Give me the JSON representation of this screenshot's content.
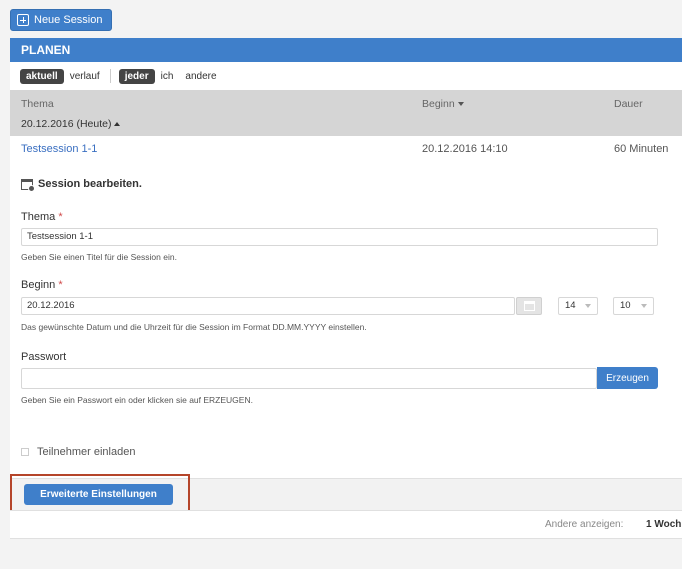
{
  "toolbar": {
    "new_session_label": "Neue Session"
  },
  "planen": {
    "title": "PLANEN"
  },
  "filters": {
    "time": [
      {
        "label": "aktuell",
        "active": true
      },
      {
        "label": "verlauf",
        "active": false
      }
    ],
    "owner": [
      {
        "label": "jeder",
        "active": true
      },
      {
        "label": "ich",
        "active": false
      },
      {
        "label": "andere",
        "active": false
      }
    ]
  },
  "table": {
    "columns": {
      "thema": "Thema",
      "beginn": "Beginn",
      "dauer": "Dauer"
    },
    "date_group": "20.12.2016 (Heute)",
    "row": {
      "thema": "Testsession 1-1",
      "beginn": "20.12.2016 14:10",
      "dauer": "60 Minuten"
    }
  },
  "form": {
    "title": "Session bearbeiten.",
    "thema": {
      "label": "Thema",
      "required_mark": "*",
      "value": "Testsession 1-1",
      "hint": "Geben Sie einen Titel für die Session ein."
    },
    "beginn": {
      "label": "Beginn",
      "required_mark": "*",
      "date_value": "20.12.2016",
      "hour": "14",
      "minute": "10",
      "hint": "Das gewünschte Datum und die Uhrzeit für die Session im Format DD.MM.YYYY einstellen."
    },
    "passwort": {
      "label": "Passwort",
      "value": "",
      "generate_label": "Erzeugen",
      "hint": "Geben Sie ein Passwort ein oder klicken sie auf ERZEUGEN."
    },
    "invite": {
      "label": "Teilnehmer einladen",
      "checked": false
    },
    "advanced_label": "Erweiterte Einstellungen"
  },
  "footer": {
    "show_other_label": "Andere anzeigen:",
    "period_value": "1 Woch"
  },
  "colors": {
    "primary": "#3f7fca",
    "highlight": "#b5452a",
    "required": "#d04848"
  }
}
